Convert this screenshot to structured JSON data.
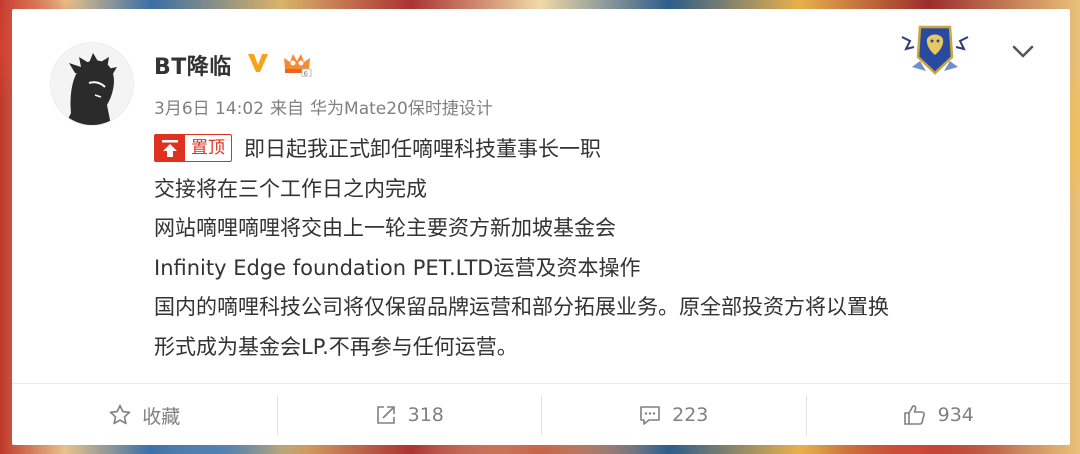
{
  "post": {
    "username": "BT降临",
    "date": "3月6日 14:02",
    "source_prefix": "来自",
    "source_device": "华为Mate20保时捷设计",
    "pinned_label": "置顶",
    "lines": [
      "即日起我正式卸任嘀哩科技董事长一职",
      "交接将在三个工作日之内完成",
      "网站嘀哩嘀哩将交由上一轮主要资方新加坡基金会",
      "Infinity Edge foundation PET.LTD运营及资本操作",
      "国内的嘀哩科技公司将仅保留品牌运营和部分拓展业务。原全部投资方将以置换",
      "形式成为基金会LP.不再参与任何运营。"
    ]
  },
  "actions": {
    "favorite_label": "收藏",
    "repost_count": "318",
    "comment_count": "223",
    "like_count": "934"
  },
  "colors": {
    "accent_red": "#e0301e",
    "vip_orange": "#f7a21b",
    "text_gray": "#808080"
  },
  "icons": {
    "verified": "verified-v-icon",
    "crown": "crown-badge-icon",
    "shield": "alliance-shield-icon",
    "chevron": "chevron-down-icon",
    "favorite": "star-icon",
    "repost": "share-arrow-icon",
    "comment": "comment-bubble-icon",
    "like": "thumbs-up-icon"
  }
}
